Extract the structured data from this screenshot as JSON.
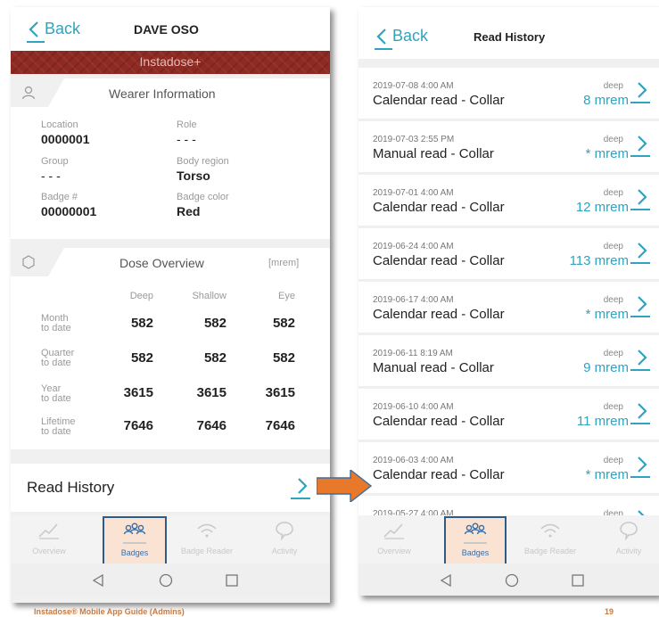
{
  "left_screen": {
    "header": {
      "back_label": "Back",
      "title": "DAVE OSO"
    },
    "brand_banner": "Instadose+",
    "wearer_info": {
      "title": "Wearer Information",
      "fields": [
        {
          "label": "Location",
          "value": "0000001"
        },
        {
          "label": "Role",
          "value": "- - -"
        },
        {
          "label": "Group",
          "value": "- - -"
        },
        {
          "label": "Body region",
          "value": "Torso"
        },
        {
          "label": "Badge #",
          "value": "00000001"
        },
        {
          "label": "Badge color",
          "value": "Red"
        }
      ]
    },
    "dose_overview": {
      "title": "Dose Overview",
      "unit": "[mrem]",
      "columns": [
        "Deep",
        "Shallow",
        "Eye"
      ],
      "rows": [
        {
          "label_line1": "Month",
          "label_line2": "to date",
          "values": [
            "582",
            "582",
            "582"
          ]
        },
        {
          "label_line1": "Quarter",
          "label_line2": "to date",
          "values": [
            "582",
            "582",
            "582"
          ]
        },
        {
          "label_line1": "Year",
          "label_line2": "to date",
          "values": [
            "3615",
            "3615",
            "3615"
          ]
        },
        {
          "label_line1": "Lifetime",
          "label_line2": "to date",
          "values": [
            "7646",
            "7646",
            "7646"
          ]
        }
      ]
    },
    "read_history_label": "Read History"
  },
  "right_screen": {
    "header": {
      "back_label": "Back",
      "title": "Read History"
    },
    "rows": [
      {
        "date": "2019-07-08 4:00 AM",
        "description": "Calendar read - Collar",
        "type": "deep",
        "dose": "8 mrem"
      },
      {
        "date": "2019-07-03 2:55 PM",
        "description": "Manual read - Collar",
        "type": "deep",
        "dose": "* mrem"
      },
      {
        "date": "2019-07-01 4:00 AM",
        "description": "Calendar read - Collar",
        "type": "deep",
        "dose": "12 mrem"
      },
      {
        "date": "2019-06-24 4:00 AM",
        "description": "Calendar read - Collar",
        "type": "deep",
        "dose": "113 mrem"
      },
      {
        "date": "2019-06-17 4:00 AM",
        "description": "Calendar read - Collar",
        "type": "deep",
        "dose": "* mrem"
      },
      {
        "date": "2019-06-11 8:19 AM",
        "description": "Manual read - Collar",
        "type": "deep",
        "dose": "9 mrem"
      },
      {
        "date": "2019-06-10 4:00 AM",
        "description": "Calendar read - Collar",
        "type": "deep",
        "dose": "11 mrem"
      },
      {
        "date": "2019-06-03 4:00 AM",
        "description": "Calendar read - Collar",
        "type": "deep",
        "dose": "* mrem"
      },
      {
        "date": "2019-05-27 4:00 AM",
        "description": "",
        "type": "deep",
        "dose": ""
      }
    ]
  },
  "tabs": [
    "Overview",
    "Badges",
    "Badge Reader",
    "Activity"
  ],
  "active_tab": "Badges",
  "footer": {
    "left": "Instadose® Mobile App Guide (Admins)",
    "page_number": "19"
  },
  "colors": {
    "accent": "#2fa3bf",
    "brand_red": "#8e2a22",
    "highlight_border": "#2f5b87",
    "arrow": "#e8782a"
  }
}
